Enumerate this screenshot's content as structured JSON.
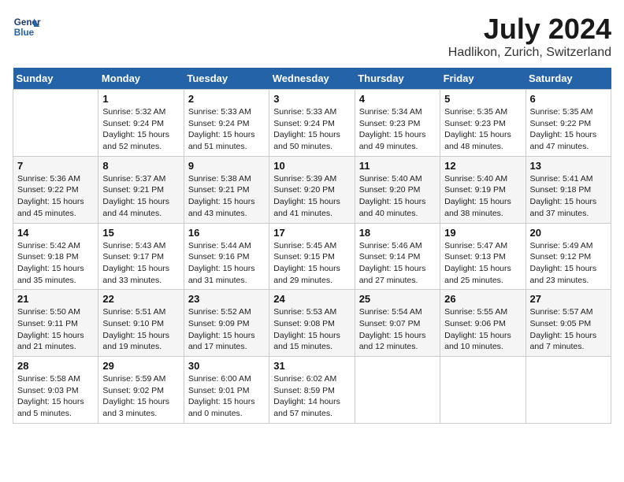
{
  "header": {
    "logo_line1": "General",
    "logo_line2": "Blue",
    "month_year": "July 2024",
    "location": "Hadlikon, Zurich, Switzerland"
  },
  "weekdays": [
    "Sunday",
    "Monday",
    "Tuesday",
    "Wednesday",
    "Thursday",
    "Friday",
    "Saturday"
  ],
  "weeks": [
    [
      {
        "day": "",
        "info": ""
      },
      {
        "day": "1",
        "info": "Sunrise: 5:32 AM\nSunset: 9:24 PM\nDaylight: 15 hours\nand 52 minutes."
      },
      {
        "day": "2",
        "info": "Sunrise: 5:33 AM\nSunset: 9:24 PM\nDaylight: 15 hours\nand 51 minutes."
      },
      {
        "day": "3",
        "info": "Sunrise: 5:33 AM\nSunset: 9:24 PM\nDaylight: 15 hours\nand 50 minutes."
      },
      {
        "day": "4",
        "info": "Sunrise: 5:34 AM\nSunset: 9:23 PM\nDaylight: 15 hours\nand 49 minutes."
      },
      {
        "day": "5",
        "info": "Sunrise: 5:35 AM\nSunset: 9:23 PM\nDaylight: 15 hours\nand 48 minutes."
      },
      {
        "day": "6",
        "info": "Sunrise: 5:35 AM\nSunset: 9:22 PM\nDaylight: 15 hours\nand 47 minutes."
      }
    ],
    [
      {
        "day": "7",
        "info": "Sunrise: 5:36 AM\nSunset: 9:22 PM\nDaylight: 15 hours\nand 45 minutes."
      },
      {
        "day": "8",
        "info": "Sunrise: 5:37 AM\nSunset: 9:21 PM\nDaylight: 15 hours\nand 44 minutes."
      },
      {
        "day": "9",
        "info": "Sunrise: 5:38 AM\nSunset: 9:21 PM\nDaylight: 15 hours\nand 43 minutes."
      },
      {
        "day": "10",
        "info": "Sunrise: 5:39 AM\nSunset: 9:20 PM\nDaylight: 15 hours\nand 41 minutes."
      },
      {
        "day": "11",
        "info": "Sunrise: 5:40 AM\nSunset: 9:20 PM\nDaylight: 15 hours\nand 40 minutes."
      },
      {
        "day": "12",
        "info": "Sunrise: 5:40 AM\nSunset: 9:19 PM\nDaylight: 15 hours\nand 38 minutes."
      },
      {
        "day": "13",
        "info": "Sunrise: 5:41 AM\nSunset: 9:18 PM\nDaylight: 15 hours\nand 37 minutes."
      }
    ],
    [
      {
        "day": "14",
        "info": "Sunrise: 5:42 AM\nSunset: 9:18 PM\nDaylight: 15 hours\nand 35 minutes."
      },
      {
        "day": "15",
        "info": "Sunrise: 5:43 AM\nSunset: 9:17 PM\nDaylight: 15 hours\nand 33 minutes."
      },
      {
        "day": "16",
        "info": "Sunrise: 5:44 AM\nSunset: 9:16 PM\nDaylight: 15 hours\nand 31 minutes."
      },
      {
        "day": "17",
        "info": "Sunrise: 5:45 AM\nSunset: 9:15 PM\nDaylight: 15 hours\nand 29 minutes."
      },
      {
        "day": "18",
        "info": "Sunrise: 5:46 AM\nSunset: 9:14 PM\nDaylight: 15 hours\nand 27 minutes."
      },
      {
        "day": "19",
        "info": "Sunrise: 5:47 AM\nSunset: 9:13 PM\nDaylight: 15 hours\nand 25 minutes."
      },
      {
        "day": "20",
        "info": "Sunrise: 5:49 AM\nSunset: 9:12 PM\nDaylight: 15 hours\nand 23 minutes."
      }
    ],
    [
      {
        "day": "21",
        "info": "Sunrise: 5:50 AM\nSunset: 9:11 PM\nDaylight: 15 hours\nand 21 minutes."
      },
      {
        "day": "22",
        "info": "Sunrise: 5:51 AM\nSunset: 9:10 PM\nDaylight: 15 hours\nand 19 minutes."
      },
      {
        "day": "23",
        "info": "Sunrise: 5:52 AM\nSunset: 9:09 PM\nDaylight: 15 hours\nand 17 minutes."
      },
      {
        "day": "24",
        "info": "Sunrise: 5:53 AM\nSunset: 9:08 PM\nDaylight: 15 hours\nand 15 minutes."
      },
      {
        "day": "25",
        "info": "Sunrise: 5:54 AM\nSunset: 9:07 PM\nDaylight: 15 hours\nand 12 minutes."
      },
      {
        "day": "26",
        "info": "Sunrise: 5:55 AM\nSunset: 9:06 PM\nDaylight: 15 hours\nand 10 minutes."
      },
      {
        "day": "27",
        "info": "Sunrise: 5:57 AM\nSunset: 9:05 PM\nDaylight: 15 hours\nand 7 minutes."
      }
    ],
    [
      {
        "day": "28",
        "info": "Sunrise: 5:58 AM\nSunset: 9:03 PM\nDaylight: 15 hours\nand 5 minutes."
      },
      {
        "day": "29",
        "info": "Sunrise: 5:59 AM\nSunset: 9:02 PM\nDaylight: 15 hours\nand 3 minutes."
      },
      {
        "day": "30",
        "info": "Sunrise: 6:00 AM\nSunset: 9:01 PM\nDaylight: 15 hours\nand 0 minutes."
      },
      {
        "day": "31",
        "info": "Sunrise: 6:02 AM\nSunset: 8:59 PM\nDaylight: 14 hours\nand 57 minutes."
      },
      {
        "day": "",
        "info": ""
      },
      {
        "day": "",
        "info": ""
      },
      {
        "day": "",
        "info": ""
      }
    ]
  ]
}
